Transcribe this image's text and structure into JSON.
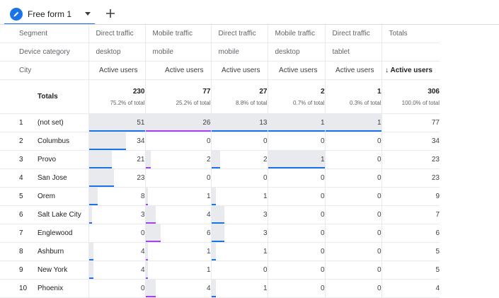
{
  "tab": {
    "label": "Free form 1",
    "icon": "pencil-icon",
    "add_icon": "plus-icon"
  },
  "colors": {
    "accent": "#1a73e8",
    "blue": "#1a73e8",
    "purple": "#a142f4",
    "barfill": "#e8eaed"
  },
  "headers": {
    "segment": {
      "label": "Segment",
      "values": [
        "Direct traffic",
        "Mobile traffic",
        "Direct traffic",
        "Mobile traffic",
        "Direct traffic",
        "Totals"
      ]
    },
    "device": {
      "label": "Device category",
      "values": [
        "desktop",
        "mobile",
        "mobile",
        "desktop",
        "tablet",
        ""
      ]
    },
    "metric": {
      "label": "City",
      "values": [
        "Active users",
        "Active users",
        "Active users",
        "Active users",
        "Active users",
        "↓ Active users"
      ]
    }
  },
  "totals": {
    "label": "Totals",
    "values": [
      "230",
      "77",
      "27",
      "2",
      "1",
      "306"
    ],
    "pcts": [
      "75.2% of total",
      "25.2% of total",
      "8.8% of total",
      "0.7% of total",
      "0.3% of total",
      "100.0% of total"
    ]
  },
  "rows": [
    {
      "num": "1",
      "city": "(not set)",
      "values": [
        "51",
        "26",
        "13",
        "1",
        "1",
        "77"
      ]
    },
    {
      "num": "2",
      "city": "Columbus",
      "values": [
        "34",
        "0",
        "0",
        "0",
        "0",
        "34"
      ]
    },
    {
      "num": "3",
      "city": "Provo",
      "values": [
        "21",
        "2",
        "2",
        "1",
        "0",
        "23"
      ]
    },
    {
      "num": "4",
      "city": "San Jose",
      "values": [
        "23",
        "0",
        "0",
        "0",
        "0",
        "23"
      ]
    },
    {
      "num": "5",
      "city": "Orem",
      "values": [
        "8",
        "1",
        "1",
        "0",
        "0",
        "9"
      ]
    },
    {
      "num": "6",
      "city": "Salt Lake City",
      "values": [
        "3",
        "4",
        "3",
        "0",
        "0",
        "7"
      ]
    },
    {
      "num": "7",
      "city": "Englewood",
      "values": [
        "0",
        "6",
        "3",
        "0",
        "0",
        "6"
      ]
    },
    {
      "num": "8",
      "city": "Ashburn",
      "values": [
        "4",
        "1",
        "1",
        "0",
        "0",
        "5"
      ]
    },
    {
      "num": "9",
      "city": "New York",
      "values": [
        "4",
        "1",
        "0",
        "0",
        "0",
        "5"
      ]
    },
    {
      "num": "10",
      "city": "Phoenix",
      "values": [
        "0",
        "4",
        "1",
        "0",
        "0",
        "4"
      ]
    }
  ],
  "column_max": [
    51,
    26,
    13,
    1,
    1
  ]
}
